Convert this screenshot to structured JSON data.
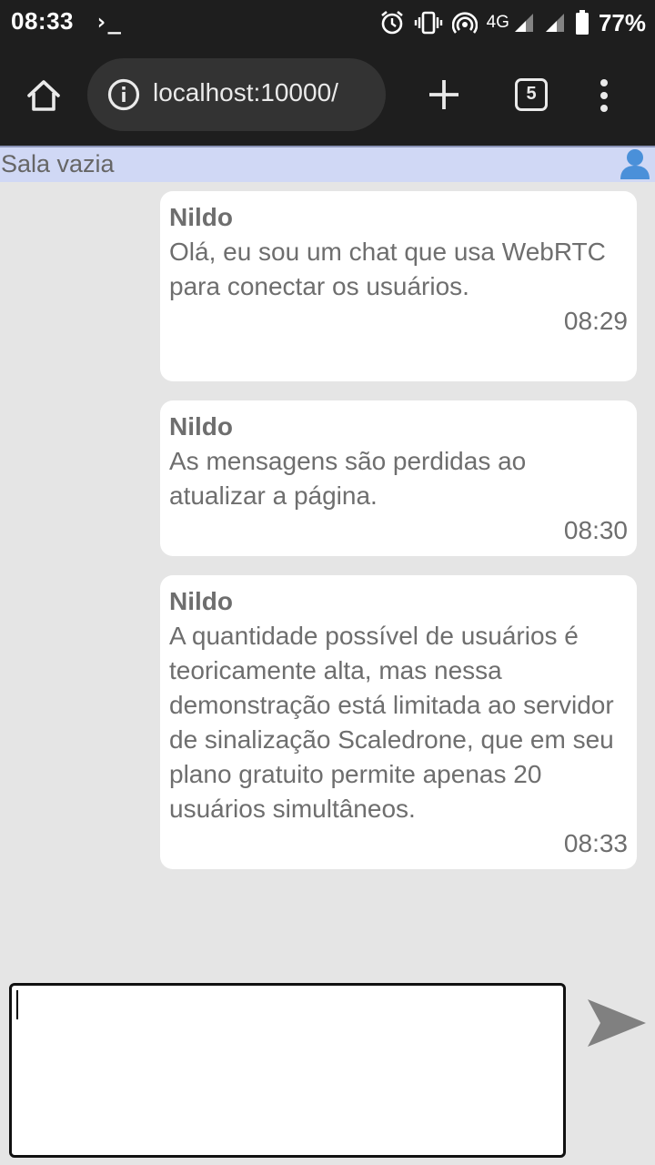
{
  "status_bar": {
    "time": "08:33",
    "terminal_glyph": "›_",
    "network": "4G",
    "battery": "77%"
  },
  "browser": {
    "url": "localhost:10000/",
    "tab_count": "5"
  },
  "room": {
    "title": "Sala vazia"
  },
  "messages": [
    {
      "sender": "Nildo",
      "text": "Olá, eu sou um chat que usa WebRTC para conectar os usuários.",
      "time": "08:29"
    },
    {
      "sender": "Nildo",
      "text": "As mensagens são perdidas ao atualizar a página.",
      "time": "08:30"
    },
    {
      "sender": "Nildo",
      "text": "A quantidade possível de usuários é teoricamente alta, mas nessa demonstração está limitada ao servidor de sinalização Scaledrone, que em seu plano gratuito permite apenas 20 usuários simultâneos.",
      "time": "08:33"
    }
  ],
  "composer": {
    "value": ""
  },
  "colors": {
    "status_bg": "#1e1e1e",
    "header_bg": "#d0d8f5",
    "chat_bg": "#e5e5e5",
    "bubble_bg": "#ffffff",
    "send_arrow": "#808080"
  },
  "icons": [
    "terminal-icon",
    "alarm-icon",
    "vibrate-icon",
    "hotspot-icon",
    "signal-icon",
    "battery-icon",
    "home-icon",
    "info-icon",
    "plus-icon",
    "tabs-icon",
    "more-vert-icon",
    "user-icon",
    "send-icon"
  ]
}
